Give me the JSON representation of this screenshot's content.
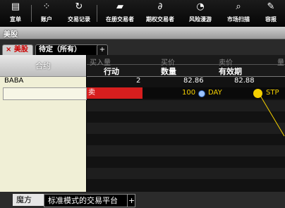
{
  "toolbar": {
    "items": [
      {
        "label": "宣单",
        "icon": "document-icon"
      },
      {
        "label": "账户",
        "icon": "account-icon"
      },
      {
        "label": "交易记录",
        "icon": "trade-log-icon"
      },
      {
        "label": "在册交易者",
        "icon": "book-icon"
      },
      {
        "label": "期权交易者",
        "icon": "option-trader-icon"
      },
      {
        "label": "风险漫游",
        "icon": "risk-navigator-icon"
      },
      {
        "label": "市场扫描",
        "icon": "scanner-icon"
      },
      {
        "label": "容报",
        "icon": "report-icon"
      }
    ]
  },
  "window": {
    "title": "美股"
  },
  "tabs": {
    "active": "× 美股",
    "second": "待定（所有）",
    "add": "+"
  },
  "grid": {
    "left_header": "合约",
    "columns": [
      {
        "top": "买入量",
        "bottom": "行动"
      },
      {
        "top": "买价",
        "bottom": "数量"
      },
      {
        "top": "卖价",
        "bottom": "有效期"
      },
      {
        "top": "量",
        "bottom": ""
      }
    ],
    "rows": [
      {
        "symbol": "BABA",
        "bid_size": "2",
        "bid": "82.86",
        "ask": "82.88"
      }
    ],
    "order": {
      "action": "卖",
      "quantity": "100",
      "tif": "DAY",
      "type": "STP"
    }
  },
  "footer": {
    "tabs": [
      "魔方",
      "标准模式的交易平台"
    ],
    "add": "+"
  },
  "colors": {
    "sell": "#d71e1e",
    "order_text": "#f5d000",
    "stripe_dark": "#121212",
    "stripe_light": "#1e1e1e"
  }
}
